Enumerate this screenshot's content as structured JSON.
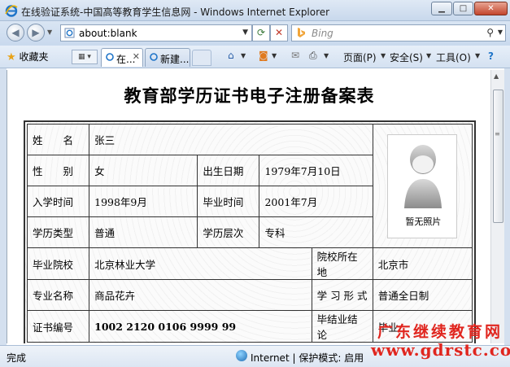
{
  "window": {
    "title": "在线验证系统-中国高等教育学生信息网 - Windows Internet Explorer"
  },
  "address_bar": {
    "url": "about:blank",
    "search_placeholder": "Bing"
  },
  "favorites_bar": {
    "favorites_label": "收藏夹",
    "tabs": [
      {
        "label": "在...",
        "active": true
      },
      {
        "label": "新建...",
        "active": false
      }
    ],
    "commands": {
      "page": "页面(P)",
      "safety": "安全(S)",
      "tools": "工具(O)"
    }
  },
  "document": {
    "title": "教育部学历证书电子注册备案表",
    "labels": {
      "name": "姓　　名",
      "gender": "性　　别",
      "birth_date": "出生日期",
      "enroll_date": "入学时间",
      "grad_date": "毕业时间",
      "edu_type": "学历类型",
      "edu_level": "学历层次",
      "school": "毕业院校",
      "school_location": "院校所在地",
      "major": "专业名称",
      "study_form": "学 习 形 式",
      "cert_no": "证书编号",
      "conclusion": "毕结业结论"
    },
    "values": {
      "name": "张三",
      "gender": "女",
      "birth_date": "1979年7月10日",
      "enroll_date": "1998年9月",
      "grad_date": "2001年7月",
      "edu_type": "普通",
      "edu_level": "专科",
      "school": "北京林业大学",
      "school_location": "北京市",
      "major": "商品花卉",
      "study_form": "普通全日制",
      "cert_no": "1002 2120 0106 9999 99",
      "conclusion": "毕业"
    },
    "photo_caption": "暂无照片"
  },
  "status_bar": {
    "status": "完成",
    "zone": "Internet | 保护模式: 启用"
  },
  "watermark": {
    "line1": "广东继续教育网",
    "line2": "www.gdrstc.com",
    "color": "#e0261f"
  }
}
